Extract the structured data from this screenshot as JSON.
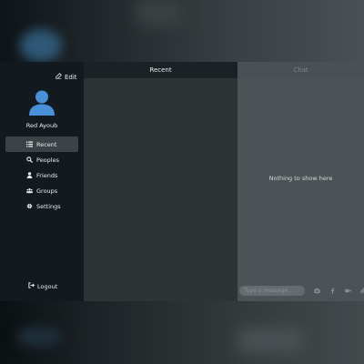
{
  "user": {
    "name": "Red Ayoub"
  },
  "sidebar": {
    "edit_label": "Edit",
    "items": [
      {
        "label": "Recent",
        "icon": "list-icon",
        "active": true
      },
      {
        "label": "Peoples",
        "icon": "search-icon",
        "active": false
      },
      {
        "label": "Friends",
        "icon": "user-icon",
        "active": false
      },
      {
        "label": "Groups",
        "icon": "users-icon",
        "active": false
      },
      {
        "label": "Settings",
        "icon": "gear-icon",
        "active": false
      }
    ],
    "logout_label": "Logout"
  },
  "recent": {
    "title": "Recent"
  },
  "chat": {
    "title": "Chat",
    "empty_message": "Nothing to show here",
    "input_placeholder": "Type a message...",
    "actions": [
      "camera-icon",
      "facebook-icon",
      "video-icon",
      "attach-icon"
    ]
  },
  "colors": {
    "sidebar_bg": "#121a1f",
    "active_item_bg": "#3c4246",
    "avatar": "#4a90d9"
  }
}
